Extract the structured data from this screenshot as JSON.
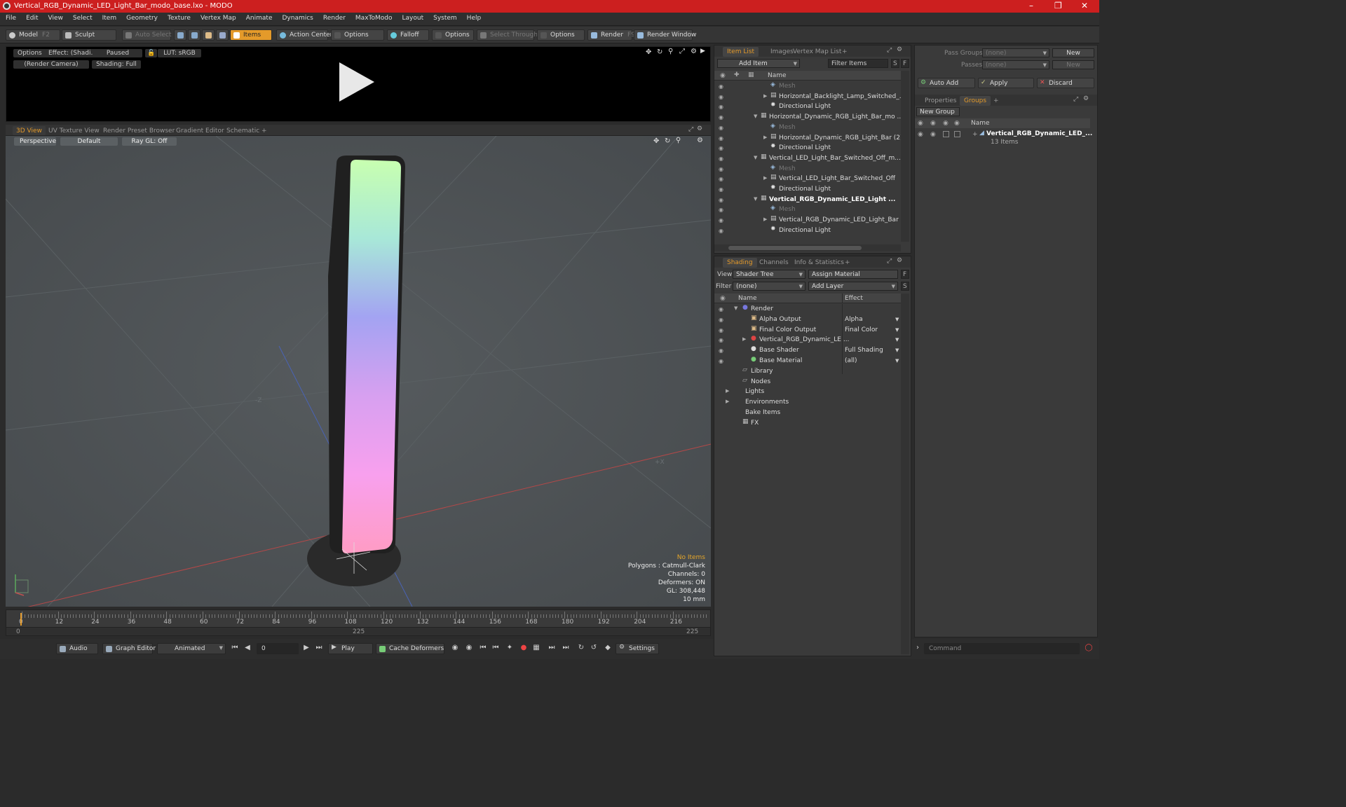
{
  "window": {
    "title": "Vertical_RGB_Dynamic_LED_Light_Bar_modo_base.lxo - MODO"
  },
  "menu": [
    "File",
    "Edit",
    "View",
    "Select",
    "Item",
    "Geometry",
    "Texture",
    "Vertex Map",
    "Animate",
    "Dynamics",
    "Render",
    "MaxToModo",
    "Layout",
    "System",
    "Help"
  ],
  "toolbar": {
    "model": "Model",
    "model_key": "F2",
    "sculpt": "Sculpt",
    "auto_select": "Auto Select",
    "items": "Items",
    "action_center": "Action Center",
    "options1": "Options",
    "falloff": "Falloff",
    "options2": "Options",
    "select_through": "Select Through",
    "options3": "Options",
    "render": "Render",
    "render_key": "F9",
    "render_window": "Render Window"
  },
  "preview": {
    "options": "Options",
    "effect": "Effect: (Shadi...",
    "paused": "Paused",
    "lut": "LUT: sRGB",
    "camera": "(Render Camera)",
    "shading": "Shading: Full"
  },
  "view_tabs": [
    "3D View",
    "UV Texture View",
    "Render Preset Browser",
    "Gradient Editor",
    "Schematic",
    "+"
  ],
  "viewport": {
    "perspective": "Perspective",
    "default": "Default",
    "raygl": "Ray GL: Off",
    "info": {
      "no_items": "No Items",
      "polygons": "Polygons : Catmull-Clark",
      "channels": "Channels: 0",
      "deformers": "Deformers: ON",
      "gl": "GL: 308,448",
      "scale": "10 mm"
    }
  },
  "timeline": {
    "ticks": [
      "0",
      "12",
      "24",
      "36",
      "48",
      "60",
      "72",
      "84",
      "96",
      "108",
      "120",
      "132",
      "144",
      "156",
      "168",
      "180",
      "192",
      "204",
      "216"
    ],
    "start": "0",
    "mid": "225",
    "end": "225"
  },
  "bottom": {
    "audio": "Audio",
    "graph_editor": "Graph Editor",
    "animated": "Animated",
    "frame": "0",
    "play": "Play",
    "cache": "Cache Deformers",
    "settings": "Settings",
    "command": "Command"
  },
  "item_list": {
    "tabs": [
      "Item List",
      "Images",
      "Vertex Map List",
      "+"
    ],
    "add_item": "Add Item",
    "filter": "Filter Items",
    "s": "S",
    "f": "F",
    "col_name": "Name",
    "rows": [
      {
        "label": "Mesh",
        "dim": true
      },
      {
        "label": "Horizontal_Backlight_Lamp_Switched_..."
      },
      {
        "label": "Directional Light"
      },
      {
        "label": "Horizontal_Dynamic_RGB_Light_Bar_mo ..."
      },
      {
        "label": "Mesh",
        "dim": true
      },
      {
        "label": "Horizontal_Dynamic_RGB_Light_Bar (2)"
      },
      {
        "label": "Directional Light"
      },
      {
        "label": "Vertical_LED_Light_Bar_Switched_Off_m..."
      },
      {
        "label": "Mesh",
        "dim": true
      },
      {
        "label": "Vertical_LED_Light_Bar_Switched_Off"
      },
      {
        "label": "Directional Light"
      },
      {
        "label": "Vertical_RGB_Dynamic_LED_Light ...",
        "bold": true
      },
      {
        "label": "Mesh",
        "dim": true
      },
      {
        "label": "Vertical_RGB_Dynamic_LED_Light_Bar ..."
      },
      {
        "label": "Directional Light"
      }
    ]
  },
  "shading": {
    "tabs": [
      "Shading",
      "Channels",
      "Info & Statistics",
      "+"
    ],
    "view_label": "View",
    "view_value": "Shader Tree",
    "assign": "Assign Material",
    "f": "F",
    "filter_label": "Filter",
    "filter_value": "(none)",
    "add_layer": "Add Layer",
    "s": "S",
    "col_name": "Name",
    "col_effect": "Effect",
    "rows": [
      {
        "label": "Render",
        "effect": ""
      },
      {
        "label": "Alpha Output",
        "effect": "Alpha"
      },
      {
        "label": "Final Color Output",
        "effect": "Final Color"
      },
      {
        "label": "Vertical_RGB_Dynamic_LE ...",
        "effect": ""
      },
      {
        "label": "Base Shader",
        "effect": "Full Shading"
      },
      {
        "label": "Base Material",
        "effect": "(all)"
      },
      {
        "label": "Library",
        "effect": ""
      },
      {
        "label": "Nodes",
        "effect": ""
      },
      {
        "label": "Lights",
        "effect": ""
      },
      {
        "label": "Environments",
        "effect": ""
      },
      {
        "label": "Bake Items",
        "effect": ""
      },
      {
        "label": "FX",
        "effect": ""
      }
    ]
  },
  "groups": {
    "pass_groups": "Pass Groups",
    "passes": "Passes",
    "none": "(none)",
    "new": "New",
    "auto_add": "Auto Add",
    "apply": "Apply",
    "discard": "Discard",
    "tabs": [
      "Properties",
      "Groups",
      "+"
    ],
    "new_group": "New Group",
    "col_name": "Name",
    "group_name": "Vertical_RGB_Dynamic_LED_...",
    "group_count": "13 Items"
  },
  "colors": {
    "accent": "#e49a2a",
    "title": "#cc1f1f"
  }
}
